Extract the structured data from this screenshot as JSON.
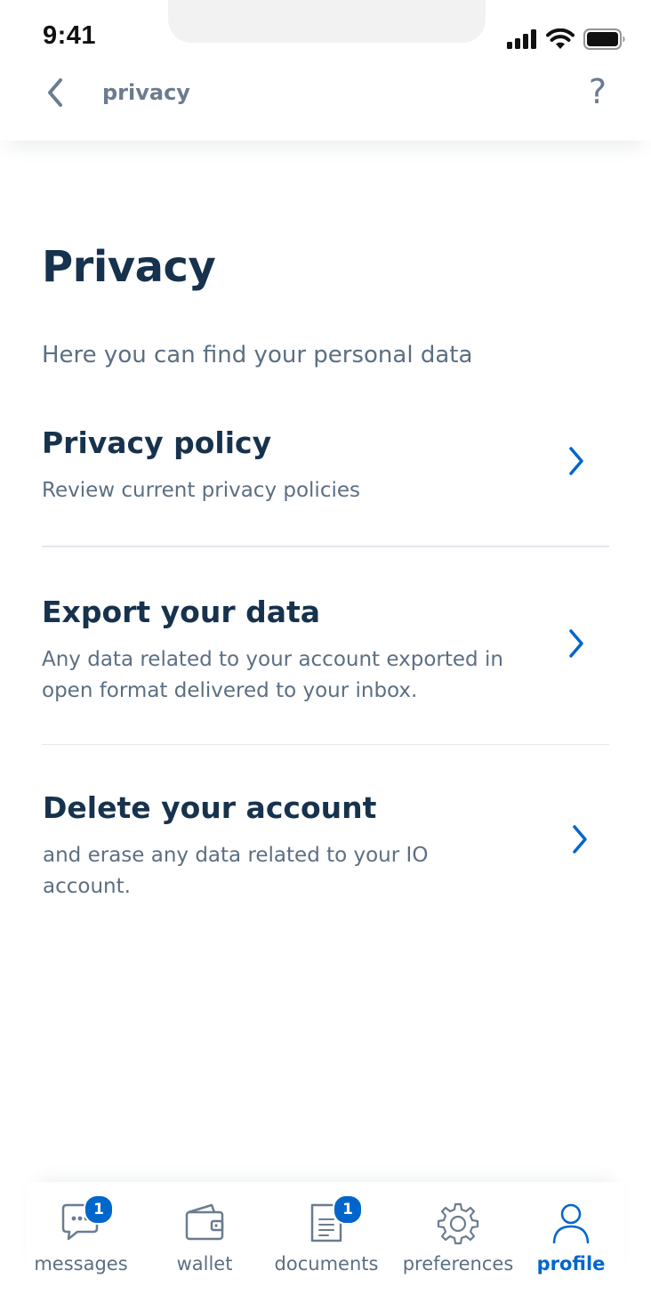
{
  "status_bar": {
    "time": "9:41"
  },
  "header": {
    "title": "privacy",
    "back_icon": "chevron-left-icon",
    "help_label": "?"
  },
  "main": {
    "title": "Privacy",
    "subtitle": "Here you can find your personal data",
    "items": [
      {
        "title": "Privacy policy",
        "description": "Review current privacy policies"
      },
      {
        "title": "Export your data",
        "description": "Any  data related to your account exported in open format delivered to your inbox."
      },
      {
        "title": "Delete your account",
        "description": "and erase any data related to your IO account."
      }
    ]
  },
  "tabbar": {
    "tabs": [
      {
        "label": "messages",
        "icon": "message-icon",
        "badge": "1"
      },
      {
        "label": "wallet",
        "icon": "wallet-icon"
      },
      {
        "label": "documents",
        "icon": "document-icon",
        "badge": "1"
      },
      {
        "label": "preferences",
        "icon": "gear-icon"
      },
      {
        "label": "profile",
        "icon": "user-icon",
        "active": true
      }
    ]
  },
  "colors": {
    "accent": "#0066cc",
    "title_text": "#17324d",
    "body_text": "#5c6f82",
    "header_text": "#6b7c8f"
  }
}
